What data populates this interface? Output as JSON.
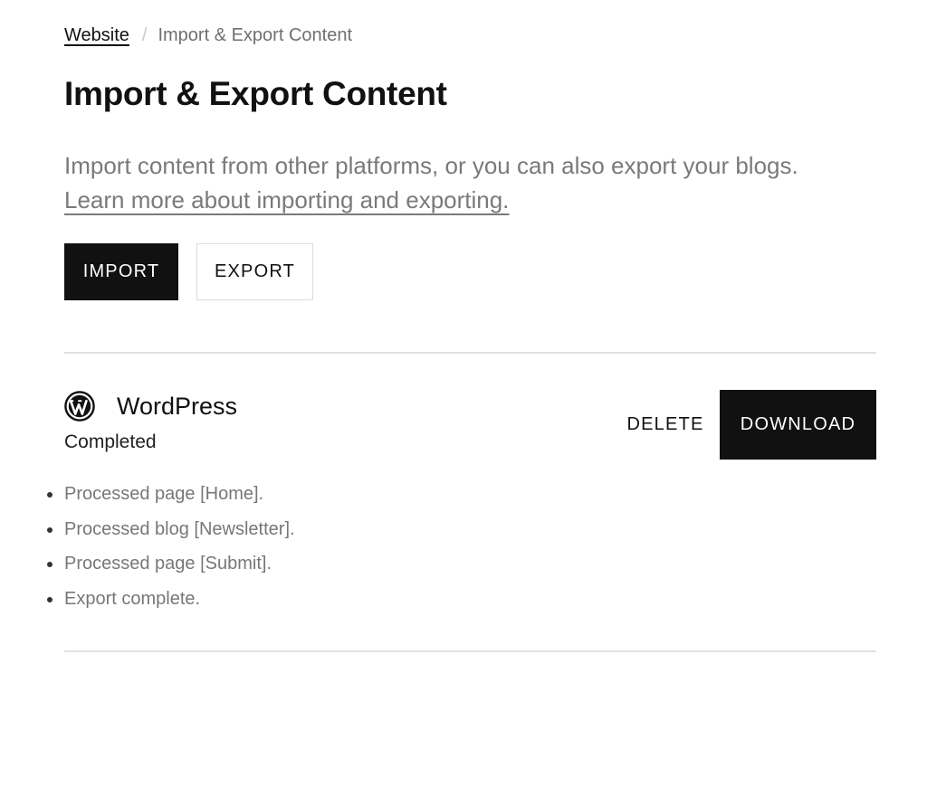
{
  "breadcrumb": {
    "parent": "Website",
    "separator": "/",
    "current": "Import & Export Content"
  },
  "page_title": "Import & Export Content",
  "description": {
    "text": "Import content from other platforms, or you can also export your blogs. ",
    "link": "Learn more about importing and exporting."
  },
  "actions": {
    "import_label": "IMPORT",
    "export_label": "EXPORT"
  },
  "job": {
    "icon": "wordpress-icon",
    "name": "WordPress",
    "status": "Completed",
    "delete_label": "DELETE",
    "download_label": "DOWNLOAD",
    "log": [
      "Processed page [Home].",
      "Processed blog [Newsletter].",
      "Processed page [Submit].",
      "Export complete."
    ]
  },
  "colors": {
    "primary": "#111111",
    "muted_text": "#7a7a7a",
    "divider": "#e1e1e1"
  }
}
